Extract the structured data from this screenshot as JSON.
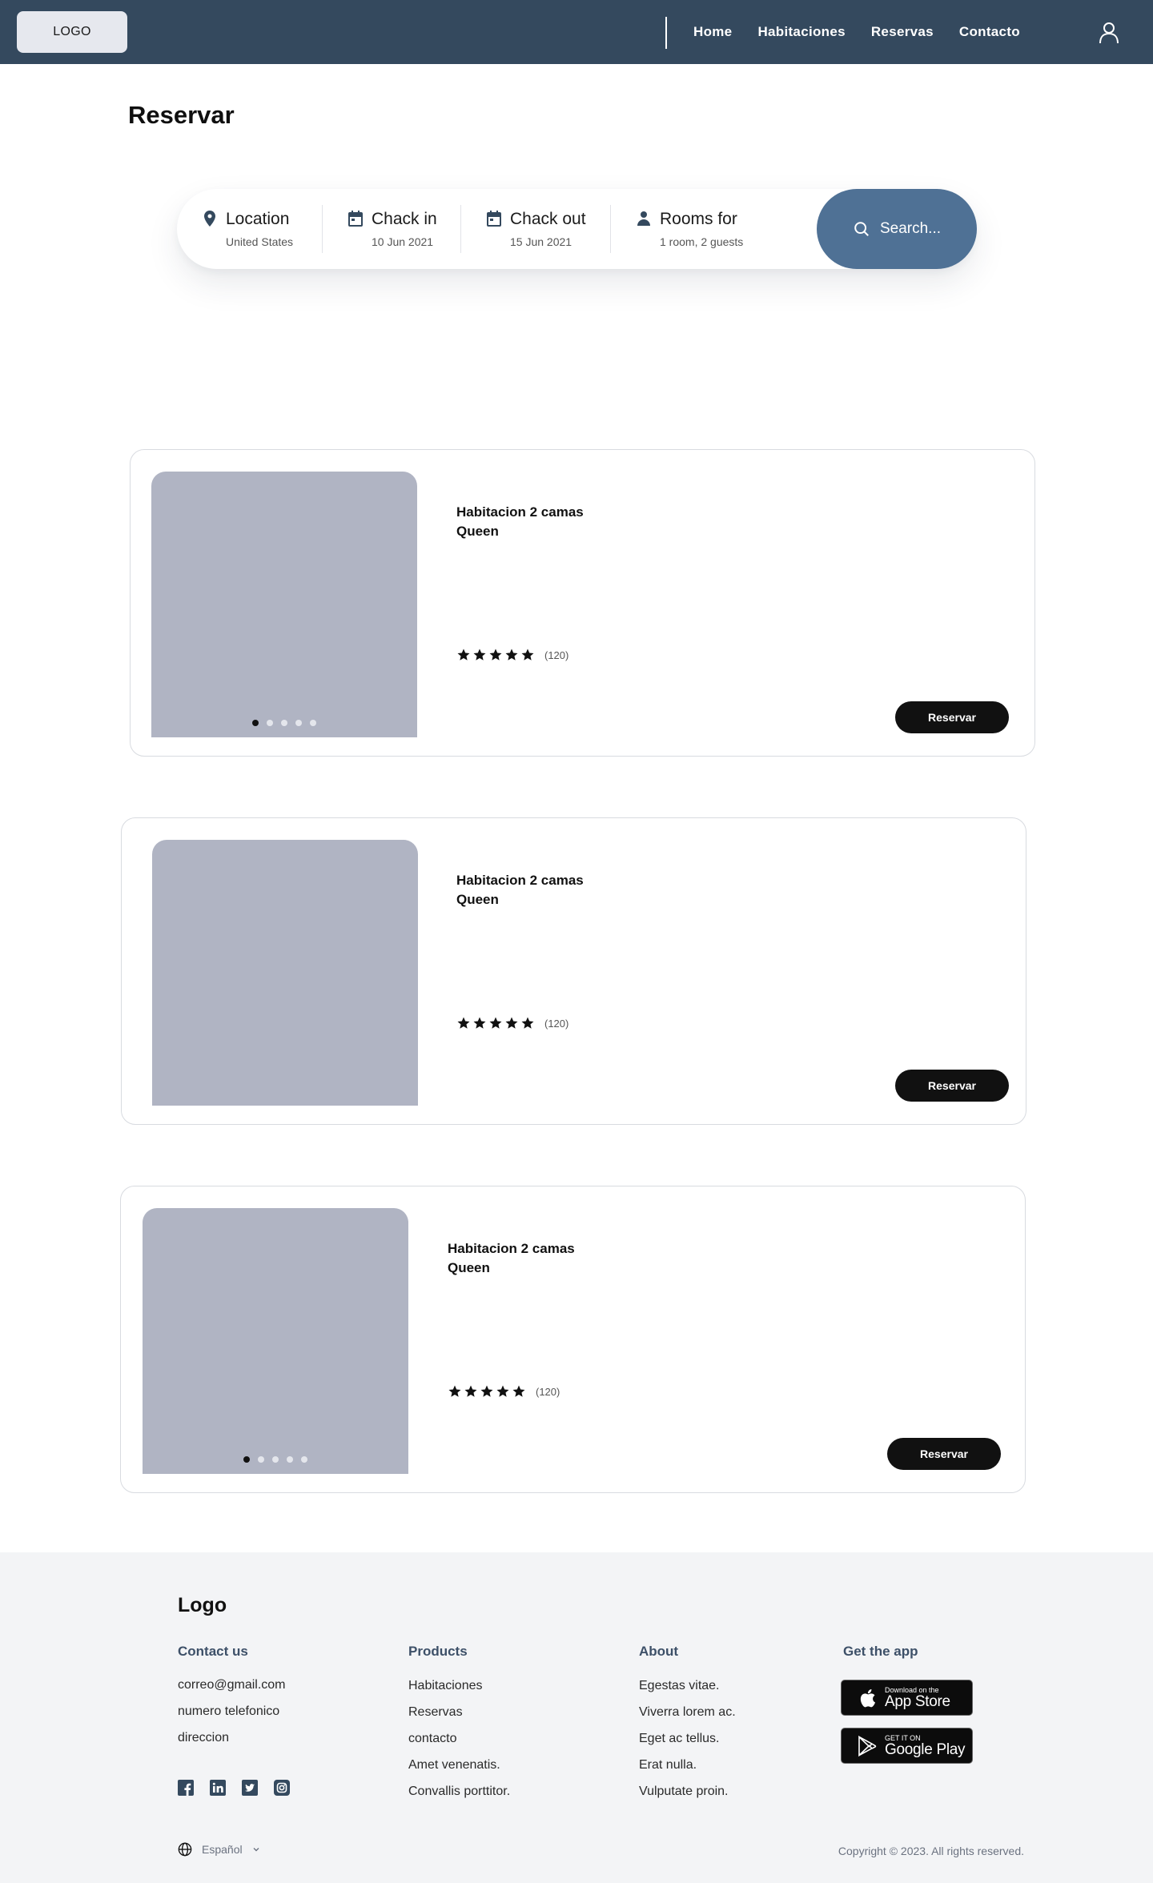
{
  "navbar": {
    "logo": "LOGO",
    "links": [
      "Home",
      "Habitaciones",
      "Reservas",
      "Contacto"
    ]
  },
  "page": {
    "title": "Reservar"
  },
  "search": {
    "location": {
      "label": "Location",
      "value": "United States",
      "icon": "location-pin-icon"
    },
    "check_in": {
      "label": "Chack in",
      "value": "10 Jun 2021",
      "icon": "calendar-icon"
    },
    "check_out": {
      "label": "Chack out",
      "value": "15 Jun 2021",
      "icon": "calendar-icon"
    },
    "rooms": {
      "label": "Rooms for",
      "value": "1 room, 2 guests",
      "icon": "person-icon"
    },
    "button": "Search..."
  },
  "rooms": [
    {
      "title": "Habitacion 2 camas Queen",
      "rating": 5,
      "review_count": "(120)",
      "button": "Reservar",
      "carousel_dots": 5,
      "active_dot": 1
    },
    {
      "title": "Habitacion 2 camas Queen",
      "rating": 5,
      "review_count": "(120)",
      "button": "Reservar",
      "carousel_dots": 0,
      "active_dot": 0
    },
    {
      "title": "Habitacion 2 camas Queen",
      "rating": 5,
      "review_count": "(120)",
      "button": "Reservar",
      "carousel_dots": 5,
      "active_dot": 1
    }
  ],
  "footer": {
    "logo": "Logo",
    "contact": {
      "title": "Contact us",
      "items": [
        "correo@gmail.com",
        "numero telefonico",
        "direccion"
      ]
    },
    "products": {
      "title": "Products",
      "items": [
        "Habitaciones",
        "Reservas",
        "contacto",
        "Amet venenatis.",
        "Convallis porttitor."
      ]
    },
    "about": {
      "title": "About",
      "items": [
        "Egestas vitae.",
        "Viverra lorem ac.",
        "Eget ac tellus.",
        "Erat nulla.",
        "Vulputate proin."
      ]
    },
    "app": {
      "title": "Get the app",
      "app_store": {
        "small": "Download on the",
        "big": "App Store"
      },
      "google_play": {
        "small": "GET IT ON",
        "big": "Google Play"
      }
    },
    "social_icons": [
      "facebook-icon",
      "linkedin-icon",
      "twitter-icon",
      "instagram-icon"
    ],
    "language": "Español",
    "copyright": "Copyright © 2023. All rights reserved."
  },
  "colors": {
    "navbar": "#34495e",
    "search_button": "#4f7195",
    "image_placeholder": "#b0b4c3",
    "footer_bg": "#f3f4f6",
    "footer_heading": "#3d5068"
  }
}
